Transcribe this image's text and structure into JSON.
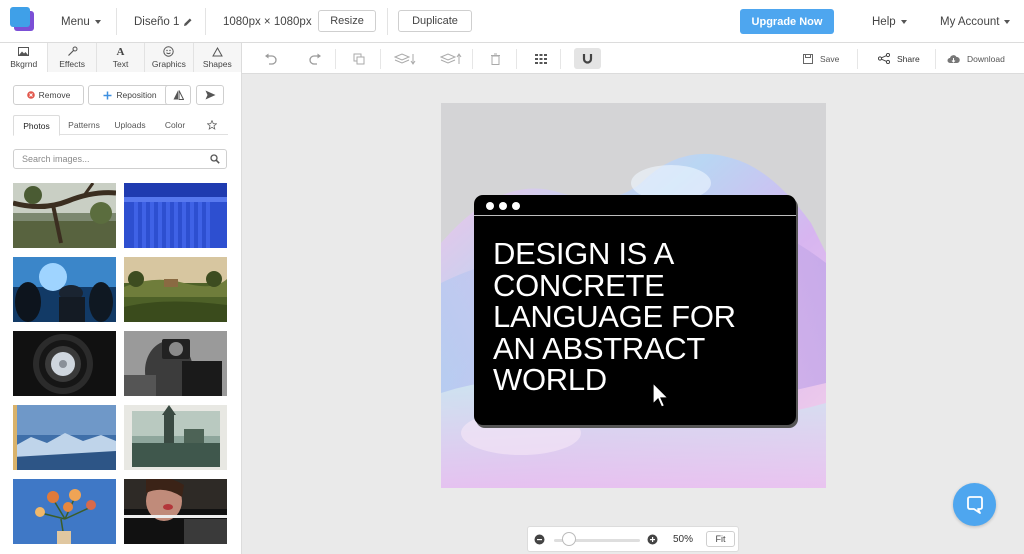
{
  "colors": {
    "accent": "#4ea6ef",
    "logo_front": "#3fa0e8",
    "logo_back": "#7b4fd6",
    "canvas_bg": "#d4d4d6"
  },
  "header": {
    "menu_label": "Menu",
    "document_name": "Diseño 1",
    "dimensions": "1080px × 1080px",
    "resize_label": "Resize",
    "duplicate_label": "Duplicate",
    "upgrade_label": "Upgrade Now",
    "help_label": "Help",
    "account_label": "My Account"
  },
  "sidebar": {
    "tabs": [
      {
        "label": "Bkgrnd",
        "icon": "image-icon",
        "active": true
      },
      {
        "label": "Effects",
        "icon": "magic-wand-icon"
      },
      {
        "label": "Text",
        "icon": "text-icon"
      },
      {
        "label": "Graphics",
        "icon": "smiley-icon"
      },
      {
        "label": "Shapes",
        "icon": "triangle-icon"
      }
    ],
    "actions": {
      "remove_label": "Remove",
      "reposition_label": "Reposition"
    },
    "subtabs": [
      {
        "label": "Photos",
        "active": true
      },
      {
        "label": "Patterns"
      },
      {
        "label": "Uploads"
      },
      {
        "label": "Color"
      }
    ],
    "search": {
      "placeholder": "Search images..."
    },
    "photos": [
      "tree-branch-photo",
      "blue-columns-photo",
      "concert-crowd-photo",
      "countryside-house-photo",
      "speaker-grille-photo",
      "camera-portrait-photo",
      "mountains-photo",
      "vintage-building-photo",
      "flowers-vase-photo",
      "woman-face-photo"
    ]
  },
  "toolbar": {
    "save_label": "Save",
    "share_label": "Share",
    "download_label": "Download"
  },
  "canvas": {
    "headline": "DESIGN IS A CONCRETE LANGUAGE FOR AN ABSTRACT WORLD"
  },
  "zoom": {
    "value": "50%",
    "level": 0.18,
    "fit_label": "Fit"
  }
}
